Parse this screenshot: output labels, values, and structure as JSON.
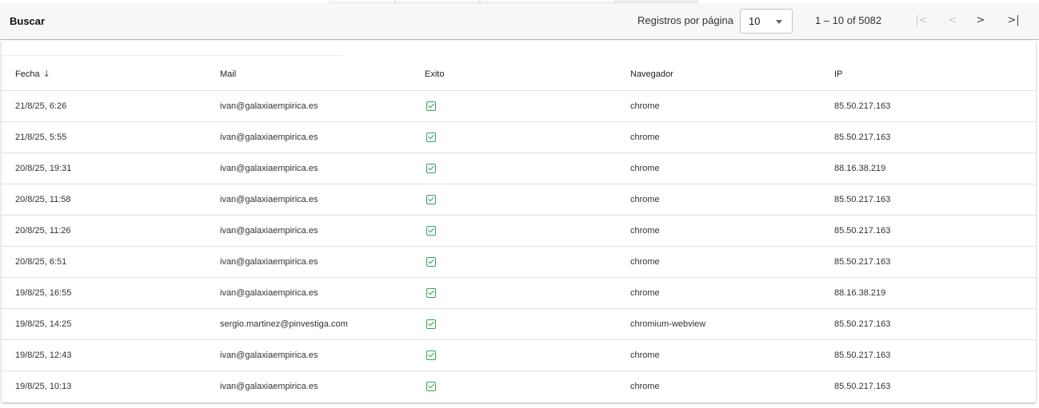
{
  "toolbar": {
    "search_label": "Buscar",
    "rows_per_page_label": "Registros por página",
    "rows_per_page_value": "10",
    "range_label": "1 – 10 of 5082",
    "first_icon": "first-page-icon",
    "prev_icon": "prev-page-icon",
    "next_icon": "next-page-icon",
    "last_icon": "last-page-icon",
    "first_glyph": "|<",
    "prev_glyph": "<",
    "next_glyph": ">",
    "last_glyph": ">|"
  },
  "table": {
    "columns": [
      "Fecha",
      "Mail",
      "Exito",
      "Navegador",
      "IP"
    ],
    "sort_icon": "arrow-down-icon",
    "sort_glyph": "↓",
    "rows": [
      {
        "fecha": "21/8/25, 6:26",
        "mail": "ivan@galaxiaempirica.es",
        "exito": true,
        "navegador": "chrome",
        "ip": "85.50.217.163"
      },
      {
        "fecha": "21/8/25, 5:55",
        "mail": "ivan@galaxiaempirica.es",
        "exito": true,
        "navegador": "chrome",
        "ip": "85.50.217.163"
      },
      {
        "fecha": "20/8/25, 19:31",
        "mail": "ivan@galaxiaempirica.es",
        "exito": true,
        "navegador": "chrome",
        "ip": "88.16.38.219"
      },
      {
        "fecha": "20/8/25, 11:58",
        "mail": "ivan@galaxiaempirica.es",
        "exito": true,
        "navegador": "chrome",
        "ip": "85.50.217.163"
      },
      {
        "fecha": "20/8/25, 11:26",
        "mail": "ivan@galaxiaempirica.es",
        "exito": true,
        "navegador": "chrome",
        "ip": "85.50.217.163"
      },
      {
        "fecha": "20/8/25, 6:51",
        "mail": "ivan@galaxiaempirica.es",
        "exito": true,
        "navegador": "chrome",
        "ip": "85.50.217.163"
      },
      {
        "fecha": "19/8/25, 16:55",
        "mail": "ivan@galaxiaempirica.es",
        "exito": true,
        "navegador": "chrome",
        "ip": "88.16.38.219"
      },
      {
        "fecha": "19/8/25, 14:25",
        "mail": "sergio.martinez@pinvestiga.com",
        "exito": true,
        "navegador": "chromium-webview",
        "ip": "85.50.217.163"
      },
      {
        "fecha": "19/8/25, 12:43",
        "mail": "ivan@galaxiaempirica.es",
        "exito": true,
        "navegador": "chrome",
        "ip": "85.50.217.163"
      },
      {
        "fecha": "19/8/25, 10:13",
        "mail": "ivan@galaxiaempirica.es",
        "exito": true,
        "navegador": "chrome",
        "ip": "85.50.217.163"
      }
    ],
    "check_icon": "checkbox-checked-icon"
  },
  "colors": {
    "check": "#3aa15a",
    "toolbar_bg": "#f7f7f7"
  }
}
